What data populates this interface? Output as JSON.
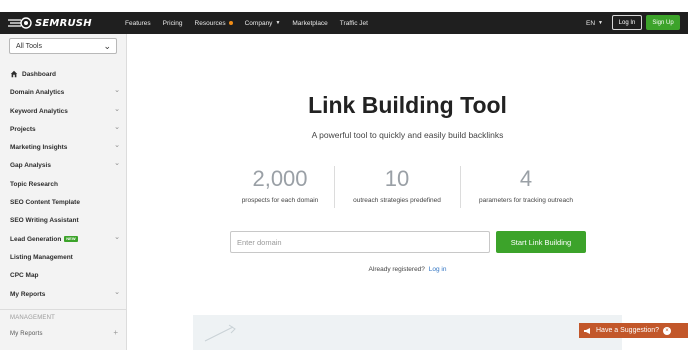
{
  "header": {
    "logo_text": "SEMRUSH",
    "nav": [
      "Features",
      "Pricing",
      "Resources",
      "Company",
      "Marketplace",
      "Traffic Jet"
    ],
    "lang": "EN",
    "login": "Log In",
    "signup": "Sign Up",
    "colors": {
      "bar": "#1f1f1f",
      "accent_dot": "#f08c16",
      "signup": "#3ca32a"
    }
  },
  "sidebar": {
    "select": "All Tools",
    "items": [
      {
        "label": "Dashboard",
        "icon": "house-icon"
      },
      {
        "label": "Domain Analytics"
      },
      {
        "label": "Keyword Analytics"
      },
      {
        "label": "Projects"
      },
      {
        "label": "Marketing Insights"
      },
      {
        "label": "Gap Analysis"
      },
      {
        "label": "Topic Research"
      },
      {
        "label": "SEO Content Template"
      },
      {
        "label": "SEO Writing Assistant"
      },
      {
        "label": "Lead Generation",
        "badge": "NEW"
      },
      {
        "label": "Listing Management"
      },
      {
        "label": "CPC Map"
      },
      {
        "label": "My Reports"
      }
    ],
    "section": "MANAGEMENT",
    "sub_item": "My Reports"
  },
  "main": {
    "title": "Link Building Tool",
    "subtitle": "A powerful tool to quickly and easily build backlinks",
    "stats": [
      {
        "value": "2,000",
        "label": "prospects for each domain"
      },
      {
        "value": "10",
        "label": "outreach strategies predefined"
      },
      {
        "value": "4",
        "label": "parameters for tracking outreach"
      }
    ],
    "input_placeholder": "Enter domain",
    "cta": "Start Link Building",
    "registered_text": "Already registered?",
    "login_link": "Log in"
  },
  "suggestion": {
    "label": "Have a Suggestion?",
    "color": "#c2572a"
  }
}
